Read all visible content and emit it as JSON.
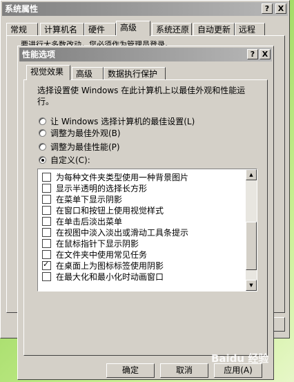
{
  "sysprops": {
    "title": "系统属性",
    "help_glyph": "?",
    "close_glyph": "X",
    "tabs": [
      "常规",
      "计算机名",
      "硬件",
      "高级",
      "系统还原",
      "自动更新",
      "远程"
    ],
    "hidden_text": "要进行大多数改动，您必须作为管理员登录。"
  },
  "perf": {
    "title": "性能选项",
    "help_glyph": "?",
    "close_glyph": "X",
    "tabs": [
      "视觉效果",
      "高级",
      "数据执行保护"
    ],
    "description": "选择设置使 Windows 在此计算机上以最佳外观和性能运行。",
    "radios": [
      {
        "label": "让 Windows 选择计算机的最佳设置(L)",
        "selected": false
      },
      {
        "label": "调整为最佳外观(B)",
        "selected": false
      },
      {
        "label": "调整为最佳性能(P)",
        "selected": false
      },
      {
        "label": "自定义(C):",
        "selected": true
      }
    ],
    "options": [
      {
        "label": "为每种文件夹类型使用一种背景图片",
        "checked": false
      },
      {
        "label": "显示半透明的选择长方形",
        "checked": false
      },
      {
        "label": "在菜单下显示阴影",
        "checked": false
      },
      {
        "label": "在窗口和按钮上使用视觉样式",
        "checked": false
      },
      {
        "label": "在单击后淡出菜单",
        "checked": false
      },
      {
        "label": "在视图中淡入淡出或滑动工具条提示",
        "checked": false
      },
      {
        "label": "在鼠标指针下显示阴影",
        "checked": false
      },
      {
        "label": "在文件夹中使用常见任务",
        "checked": false
      },
      {
        "label": "在桌面上为图标标签使用阴影",
        "checked": true
      },
      {
        "label": "在最大化和最小化时动画窗口",
        "checked": false
      }
    ],
    "buttons": {
      "ok": "确定",
      "cancel": "取消",
      "apply": "应用(A)"
    }
  },
  "watermark": "Baidu 经验"
}
